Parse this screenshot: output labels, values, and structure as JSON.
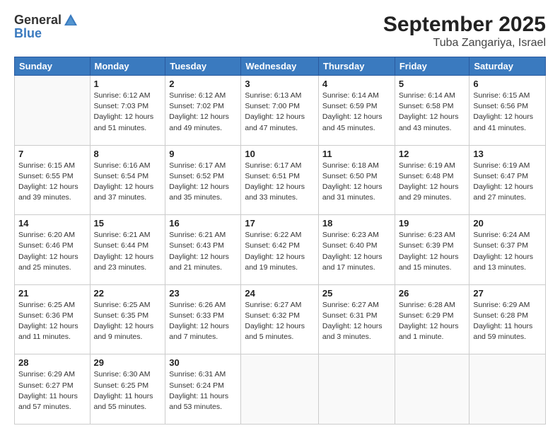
{
  "logo": {
    "general": "General",
    "blue": "Blue"
  },
  "header": {
    "month_year": "September 2025",
    "location": "Tuba Zangariya, Israel"
  },
  "days_of_week": [
    "Sunday",
    "Monday",
    "Tuesday",
    "Wednesday",
    "Thursday",
    "Friday",
    "Saturday"
  ],
  "weeks": [
    [
      {
        "day": "",
        "info": ""
      },
      {
        "day": "1",
        "info": "Sunrise: 6:12 AM\nSunset: 7:03 PM\nDaylight: 12 hours\nand 51 minutes."
      },
      {
        "day": "2",
        "info": "Sunrise: 6:12 AM\nSunset: 7:02 PM\nDaylight: 12 hours\nand 49 minutes."
      },
      {
        "day": "3",
        "info": "Sunrise: 6:13 AM\nSunset: 7:00 PM\nDaylight: 12 hours\nand 47 minutes."
      },
      {
        "day": "4",
        "info": "Sunrise: 6:14 AM\nSunset: 6:59 PM\nDaylight: 12 hours\nand 45 minutes."
      },
      {
        "day": "5",
        "info": "Sunrise: 6:14 AM\nSunset: 6:58 PM\nDaylight: 12 hours\nand 43 minutes."
      },
      {
        "day": "6",
        "info": "Sunrise: 6:15 AM\nSunset: 6:56 PM\nDaylight: 12 hours\nand 41 minutes."
      }
    ],
    [
      {
        "day": "7",
        "info": "Sunrise: 6:15 AM\nSunset: 6:55 PM\nDaylight: 12 hours\nand 39 minutes."
      },
      {
        "day": "8",
        "info": "Sunrise: 6:16 AM\nSunset: 6:54 PM\nDaylight: 12 hours\nand 37 minutes."
      },
      {
        "day": "9",
        "info": "Sunrise: 6:17 AM\nSunset: 6:52 PM\nDaylight: 12 hours\nand 35 minutes."
      },
      {
        "day": "10",
        "info": "Sunrise: 6:17 AM\nSunset: 6:51 PM\nDaylight: 12 hours\nand 33 minutes."
      },
      {
        "day": "11",
        "info": "Sunrise: 6:18 AM\nSunset: 6:50 PM\nDaylight: 12 hours\nand 31 minutes."
      },
      {
        "day": "12",
        "info": "Sunrise: 6:19 AM\nSunset: 6:48 PM\nDaylight: 12 hours\nand 29 minutes."
      },
      {
        "day": "13",
        "info": "Sunrise: 6:19 AM\nSunset: 6:47 PM\nDaylight: 12 hours\nand 27 minutes."
      }
    ],
    [
      {
        "day": "14",
        "info": "Sunrise: 6:20 AM\nSunset: 6:46 PM\nDaylight: 12 hours\nand 25 minutes."
      },
      {
        "day": "15",
        "info": "Sunrise: 6:21 AM\nSunset: 6:44 PM\nDaylight: 12 hours\nand 23 minutes."
      },
      {
        "day": "16",
        "info": "Sunrise: 6:21 AM\nSunset: 6:43 PM\nDaylight: 12 hours\nand 21 minutes."
      },
      {
        "day": "17",
        "info": "Sunrise: 6:22 AM\nSunset: 6:42 PM\nDaylight: 12 hours\nand 19 minutes."
      },
      {
        "day": "18",
        "info": "Sunrise: 6:23 AM\nSunset: 6:40 PM\nDaylight: 12 hours\nand 17 minutes."
      },
      {
        "day": "19",
        "info": "Sunrise: 6:23 AM\nSunset: 6:39 PM\nDaylight: 12 hours\nand 15 minutes."
      },
      {
        "day": "20",
        "info": "Sunrise: 6:24 AM\nSunset: 6:37 PM\nDaylight: 12 hours\nand 13 minutes."
      }
    ],
    [
      {
        "day": "21",
        "info": "Sunrise: 6:25 AM\nSunset: 6:36 PM\nDaylight: 12 hours\nand 11 minutes."
      },
      {
        "day": "22",
        "info": "Sunrise: 6:25 AM\nSunset: 6:35 PM\nDaylight: 12 hours\nand 9 minutes."
      },
      {
        "day": "23",
        "info": "Sunrise: 6:26 AM\nSunset: 6:33 PM\nDaylight: 12 hours\nand 7 minutes."
      },
      {
        "day": "24",
        "info": "Sunrise: 6:27 AM\nSunset: 6:32 PM\nDaylight: 12 hours\nand 5 minutes."
      },
      {
        "day": "25",
        "info": "Sunrise: 6:27 AM\nSunset: 6:31 PM\nDaylight: 12 hours\nand 3 minutes."
      },
      {
        "day": "26",
        "info": "Sunrise: 6:28 AM\nSunset: 6:29 PM\nDaylight: 12 hours\nand 1 minute."
      },
      {
        "day": "27",
        "info": "Sunrise: 6:29 AM\nSunset: 6:28 PM\nDaylight: 11 hours\nand 59 minutes."
      }
    ],
    [
      {
        "day": "28",
        "info": "Sunrise: 6:29 AM\nSunset: 6:27 PM\nDaylight: 11 hours\nand 57 minutes."
      },
      {
        "day": "29",
        "info": "Sunrise: 6:30 AM\nSunset: 6:25 PM\nDaylight: 11 hours\nand 55 minutes."
      },
      {
        "day": "30",
        "info": "Sunrise: 6:31 AM\nSunset: 6:24 PM\nDaylight: 11 hours\nand 53 minutes."
      },
      {
        "day": "",
        "info": ""
      },
      {
        "day": "",
        "info": ""
      },
      {
        "day": "",
        "info": ""
      },
      {
        "day": "",
        "info": ""
      }
    ]
  ]
}
